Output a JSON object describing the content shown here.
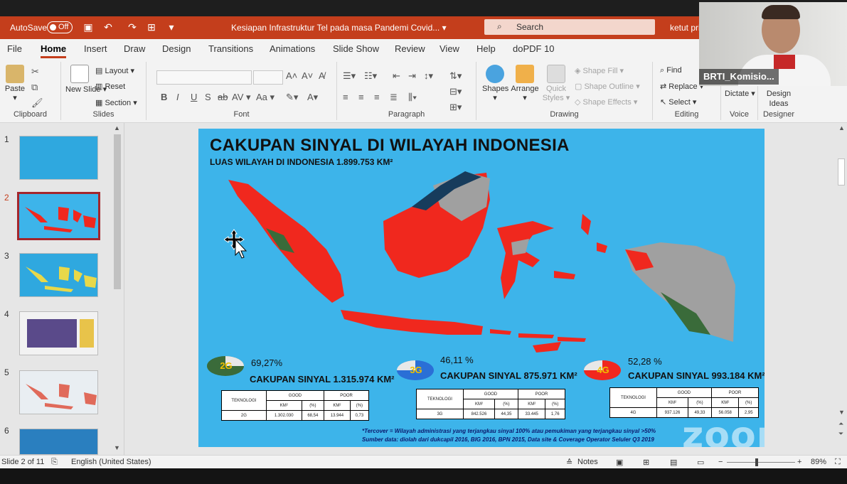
{
  "window": {
    "autosave_label": "AutoSave",
    "autosave_state": "Off",
    "doc_title": "Kesiapan Infrastruktur Tel pada masa Pandemi Covid... ▾",
    "search_placeholder": "Search",
    "user_name": "ketut pri"
  },
  "menu": {
    "tabs": [
      "File",
      "Home",
      "Insert",
      "Draw",
      "Design",
      "Transitions",
      "Animations",
      "Slide Show",
      "Review",
      "View",
      "Help",
      "doPDF 10"
    ],
    "active": "Home"
  },
  "ribbon": {
    "clipboard": {
      "paste": "Paste",
      "label": "Clipboard"
    },
    "slides": {
      "new_slide": "New Slide ▾",
      "layout": "Layout ▾",
      "reset": "Reset",
      "section": "Section ▾",
      "label": "Slides"
    },
    "font": {
      "label": "Font",
      "bold": "B",
      "italic": "I",
      "underline": "U",
      "strike": "S",
      "shadow": "ab",
      "spacing": "AV ▾",
      "case": "Aa ▾"
    },
    "paragraph": {
      "label": "Paragraph"
    },
    "drawing": {
      "shapes": "Shapes",
      "arrange": "Arrange",
      "quick_styles": "Quick Styles ▾",
      "shape_fill": "Shape Fill ▾",
      "shape_outline": "Shape Outline ▾",
      "shape_effects": "Shape Effects ▾",
      "label": "Drawing"
    },
    "editing": {
      "find": "Find",
      "replace": "Replace ▾",
      "select": "Select ▾",
      "label": "Editing"
    },
    "voice": {
      "dictate": "Dictate ▾",
      "label": "Voice"
    },
    "designer": {
      "design_ideas": "Design Ideas",
      "label": "Designer"
    }
  },
  "thumbnails": [
    {
      "num": "1",
      "selected": false,
      "color": "#2fa8df"
    },
    {
      "num": "2",
      "selected": true,
      "color": "#3db4ea"
    },
    {
      "num": "3",
      "selected": false,
      "color": "#2fa8df"
    },
    {
      "num": "4",
      "selected": false,
      "color": "#f0f0f0"
    },
    {
      "num": "5",
      "selected": false,
      "color": "#e9eef2"
    },
    {
      "num": "6",
      "selected": false,
      "color": "#2a7fbf"
    }
  ],
  "slide": {
    "title": "CAKUPAN SINYAL DI WILAYAH INDONESIA",
    "subtitle": "LUAS WILAYAH DI INDONESIA 1.899.753 KM²",
    "g2": {
      "badge": "2G",
      "pct": "69,27%",
      "coverage": "CAKUPAN SINYAL 1.315.974 KM²",
      "table": {
        "h_tech": "TEKNOLOGI",
        "h_good": "GOOD",
        "h_poor": "POOR",
        "h_km": "KM²",
        "h_pct": "(%)",
        "tech": "2G",
        "good_km": "1.302.030",
        "good_pct": "68,54",
        "poor_km": "13.944",
        "poor_pct": "0,73"
      }
    },
    "g3": {
      "badge": "3G",
      "pct": "46,11 %",
      "coverage": "CAKUPAN SINYAL 875.971 KM²",
      "table": {
        "h_tech": "TEKNOLOGI",
        "h_good": "GOOD",
        "h_poor": "POOR",
        "h_km": "KM²",
        "h_pct": "(%)",
        "tech": "3G",
        "good_km": "842.526",
        "good_pct": "44,35",
        "poor_km": "33.445",
        "poor_pct": "1,76"
      }
    },
    "g4": {
      "badge": "4G",
      "pct": "52,28 %",
      "coverage": "CAKUPAN SINYAL 993.184 KM²",
      "table": {
        "h_tech": "TEKNOLOGI",
        "h_good": "GOOD",
        "h_poor": "POOR",
        "h_km": "KM²",
        "h_pct": "(%)",
        "tech": "4G",
        "good_km": "937.126",
        "good_pct": "49,33",
        "poor_km": "56.058",
        "poor_pct": "2,95"
      }
    },
    "footnote1": "*Tercover = Wilayah administrasi yang terjangkau sinyal 100% atau pemukiman yang terjangkau sinyal >50%",
    "footnote2": "Sumber data: diolah dari dukcapil 2016, BIG 2016, BPN 2015, Data site & Coverage Operator Seluler Q3 2019",
    "watermark": "zoom"
  },
  "status": {
    "slide_count": "Slide 2 of 11",
    "language": "English (United States)",
    "notes": "Notes",
    "zoom_pct": "89%",
    "zoom_minus": "−",
    "zoom_plus": "+"
  },
  "webcam": {
    "name": "BRTI_Komisio..."
  },
  "colors": {
    "accent": "#c43e1c",
    "slide_bg": "#3db4ea",
    "coverage_red": "#f0281e",
    "no_coverage_gray": "#a0a0a0",
    "forest_green": "#3a6b3a"
  }
}
